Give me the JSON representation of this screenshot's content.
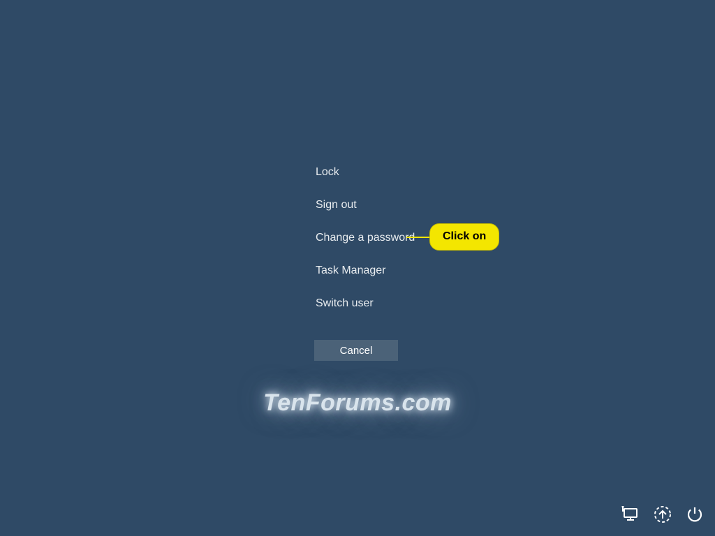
{
  "menu": {
    "items": [
      {
        "label": "Lock"
      },
      {
        "label": "Sign out"
      },
      {
        "label": "Change a password"
      },
      {
        "label": "Task Manager"
      },
      {
        "label": "Switch user"
      }
    ],
    "cancel_label": "Cancel"
  },
  "callout": {
    "text": "Click on"
  },
  "watermark": {
    "text": "TenForums.com"
  },
  "icons": {
    "network": "network-icon",
    "ease": "ease-of-access-icon",
    "power": "power-icon"
  }
}
